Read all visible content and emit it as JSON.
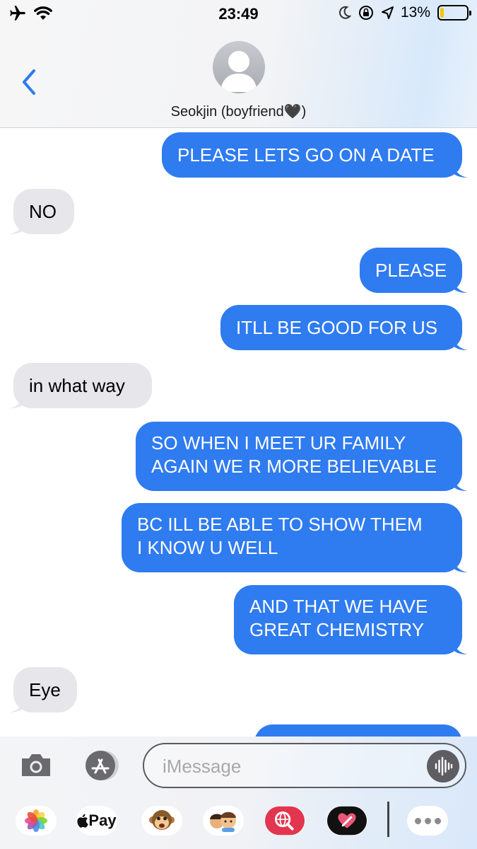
{
  "status_bar": {
    "time": "23:49",
    "battery_percent": "13%",
    "battery_level": 0.13,
    "icons": [
      "airplane-icon",
      "wifi-icon",
      "moon-icon",
      "rotation-lock-icon",
      "location-icon",
      "battery-icon"
    ]
  },
  "header": {
    "contact_name": "Seokjin (boyfriend🖤)",
    "back_icon": "chevron-left-icon",
    "avatar_icon": "person-silhouette-icon"
  },
  "messages": [
    {
      "side": "sent",
      "text": "PLEASE LETS GO ON A DATE"
    },
    {
      "side": "received",
      "text": "NO"
    },
    {
      "side": "sent",
      "text": "PLEASE"
    },
    {
      "side": "sent",
      "text": "ITLL BE GOOD FOR US"
    },
    {
      "side": "received",
      "text": "in what way"
    },
    {
      "side": "sent",
      "line1": "SO WHEN I MEET UR FAMILY",
      "line2": "AGAIN WE R MORE BELIEVABLE"
    },
    {
      "side": "sent",
      "line1": "BC ILL BE ABLE TO SHOW THEM",
      "line2": "I KNOW U WELL"
    },
    {
      "side": "sent",
      "line1": "AND THAT WE HAVE",
      "line2": "GREAT CHEMISTRY"
    },
    {
      "side": "received",
      "text": "Eye"
    }
  ],
  "input": {
    "placeholder": "iMessage"
  },
  "app_drawer": {
    "pay_label": "Pay",
    "apps": [
      "photos-icon",
      "apple-pay-icon",
      "monkey-animoji-icon",
      "memoji-icon",
      "web-search-icon",
      "digital-touch-icon",
      "more-icon"
    ]
  },
  "colors": {
    "sent_bubble": "#2f7bf0",
    "received_bubble": "#e6e6eb",
    "accent": "#2f7bf0"
  }
}
